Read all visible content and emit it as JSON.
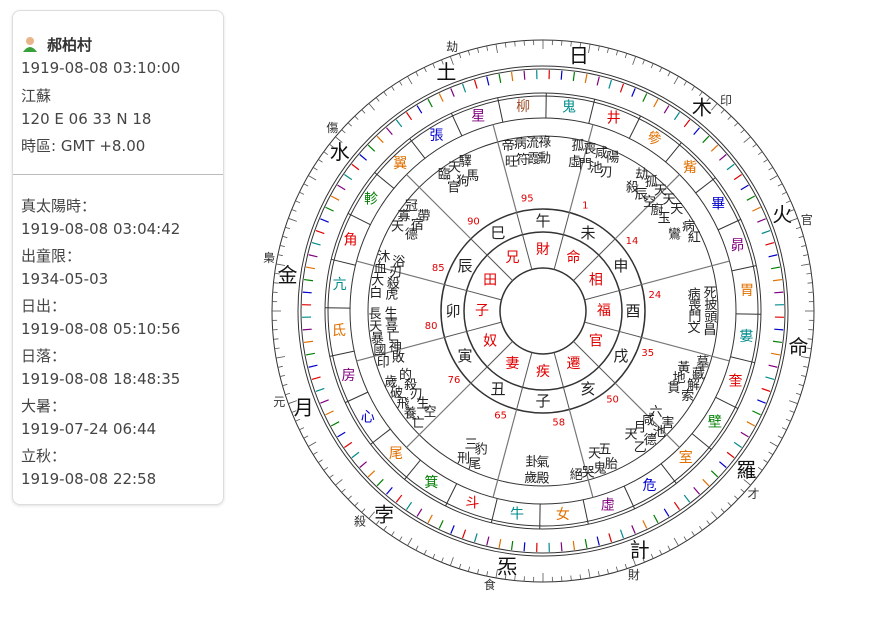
{
  "profile": {
    "name": "郝柏村",
    "datetime": "1919-08-08 03:10:00",
    "place": "江蘇",
    "coords": "120 E 06  33 N 18",
    "timezone": "時區: GMT +8.00"
  },
  "details": {
    "true_solar_label": "真太陽時：",
    "true_solar_value": "1919-08-08 03:04:42",
    "start_luck_label": "出童限：",
    "start_luck_value": "1934-05-03",
    "sunrise_label": "日出：",
    "sunrise_value": "1919-08-08 05:10:56",
    "sunset_label": "日落：",
    "sunset_value": "1919-08-08 18:48:35",
    "term1_label": "大暑：",
    "term1_value": "1919-07-24 06:44",
    "term2_label": "立秋：",
    "term2_value": "1919-08-08 22:58"
  },
  "chart": {
    "branches": [
      "午",
      "未",
      "申",
      "酉",
      "戌",
      "亥",
      "子",
      "丑",
      "寅",
      "卯",
      "辰",
      "巳"
    ],
    "palaces": [
      "財",
      "命",
      "相",
      "福",
      "官",
      "遷",
      "疾",
      "妻",
      "奴",
      "子",
      "田",
      "兄"
    ],
    "ages": [
      "95",
      "1",
      "14",
      "24",
      "35",
      "50",
      "58",
      "65",
      "76",
      "80",
      "85",
      "90"
    ],
    "stars": [
      [
        "帝旺",
        "病符",
        "流霞",
        "祿勳"
      ],
      [
        "孤虛",
        "喪門",
        "咸池",
        "陽刃"
      ],
      [
        "劫殺",
        "孤辰",
        "天空",
        "天廚",
        "天玉"
      ],
      [
        "病鸞",
        "紅"
      ],
      [
        "死病",
        "披喪",
        "頭門",
        "昌文"
      ],
      [
        "墓",
        "藏黃",
        "解地",
        "索貫"
      ],
      [
        "害六",
        "池咸",
        "德月",
        "乙天"
      ],
      [
        "胎五",
        "鬼天",
        "哭",
        "絕"
      ],
      [
        "殿氣",
        "歲卦"
      ],
      [
        "尾豹",
        "刑三"
      ],
      [
        "亡空",
        "養生",
        "飛刃",
        "破殺",
        "歲的"
      ],
      [
        "印敗",
        "國神",
        "暴亡",
        "天喜",
        "長生"
      ],
      [
        "白虎",
        "大殺",
        "血刃",
        "沐浴"
      ],
      [
        "天德",
        "寡宿",
        "冠帶"
      ],
      [
        "臨官",
        "天狗",
        "驛馬"
      ]
    ],
    "mansions": [
      {
        "n": "柳",
        "c": "#a0522d"
      },
      {
        "n": "鬼",
        "c": "#008b8b"
      },
      {
        "n": "井",
        "c": "#e00000"
      },
      {
        "n": "參",
        "c": "#e07000"
      },
      {
        "n": "觜",
        "c": "#e07000"
      },
      {
        "n": "畢",
        "c": "#0000cc"
      },
      {
        "n": "昴",
        "c": "#800080"
      },
      {
        "n": "胃",
        "c": "#e07000"
      },
      {
        "n": "婁",
        "c": "#008b8b"
      },
      {
        "n": "奎",
        "c": "#e00000"
      },
      {
        "n": "壁",
        "c": "#008000"
      },
      {
        "n": "室",
        "c": "#e07000"
      },
      {
        "n": "危",
        "c": "#0000cc"
      },
      {
        "n": "虛",
        "c": "#800080"
      },
      {
        "n": "女",
        "c": "#e07000"
      },
      {
        "n": "牛",
        "c": "#008b8b"
      },
      {
        "n": "斗",
        "c": "#e00000"
      },
      {
        "n": "箕",
        "c": "#008000"
      },
      {
        "n": "尾",
        "c": "#e07000"
      },
      {
        "n": "心",
        "c": "#0000cc"
      },
      {
        "n": "房",
        "c": "#800080"
      },
      {
        "n": "氐",
        "c": "#e07000"
      },
      {
        "n": "亢",
        "c": "#008b8b"
      },
      {
        "n": "角",
        "c": "#e00000"
      },
      {
        "n": "軫",
        "c": "#008000"
      },
      {
        "n": "翼",
        "c": "#e07000"
      },
      {
        "n": "張",
        "c": "#0000cc"
      },
      {
        "n": "星",
        "c": "#800080"
      }
    ],
    "planets": [
      {
        "n": "日",
        "s": ""
      },
      {
        "n": "木",
        "s": "印"
      },
      {
        "n": "火",
        "s": "官"
      },
      {
        "n": "命",
        "s": ""
      },
      {
        "n": "羅",
        "s": "才"
      },
      {
        "n": "計",
        "s": "財"
      },
      {
        "n": "炁",
        "s": "食"
      },
      {
        "n": "孛",
        "s": "殺"
      },
      {
        "n": "月",
        "s": "元"
      },
      {
        "n": "金",
        "s": "梟"
      },
      {
        "n": "水",
        "s": "傷"
      },
      {
        "n": "土",
        "s": "劫"
      }
    ]
  }
}
